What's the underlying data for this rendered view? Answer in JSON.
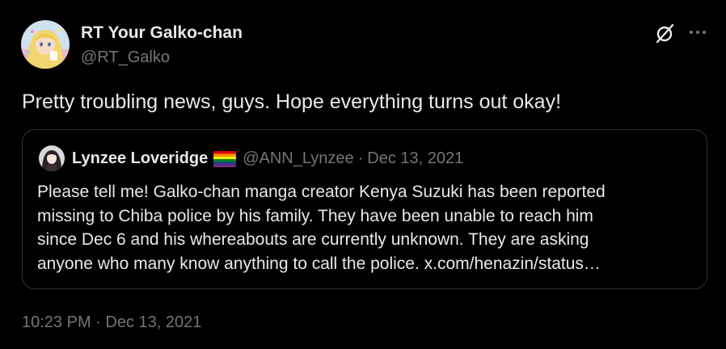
{
  "author": {
    "name": "RT Your Galko-chan",
    "handle": "@RT_Galko"
  },
  "tweet": {
    "text": "Pretty troubling news, guys. Hope everything turns out okay!"
  },
  "quote": {
    "name": "Lynzee Loveridge",
    "handle": "@ANN_Lynzee",
    "separator": "·",
    "date": "Dec 13, 2021",
    "lines": [
      "Please tell me! Galko-chan manga creator Kenya Suzuki has been reported",
      "missing to Chiba police by his family. They have been unable to reach him",
      "since Dec 6 and his whereabouts are currently unknown. They are asking",
      "anyone who many know anything to call the police. x.com/henazin/status…"
    ]
  },
  "timestamp": {
    "time": "10:23 PM",
    "separator": "·",
    "date": "Dec 13, 2021"
  },
  "icons": {
    "grok": "grok-icon",
    "more": "more-icon",
    "flag": "rainbow-flag-icon"
  },
  "colors": {
    "background": "#000000",
    "primary_text": "#e7e9ea",
    "secondary_text": "#71767b",
    "border": "#2f3336"
  }
}
